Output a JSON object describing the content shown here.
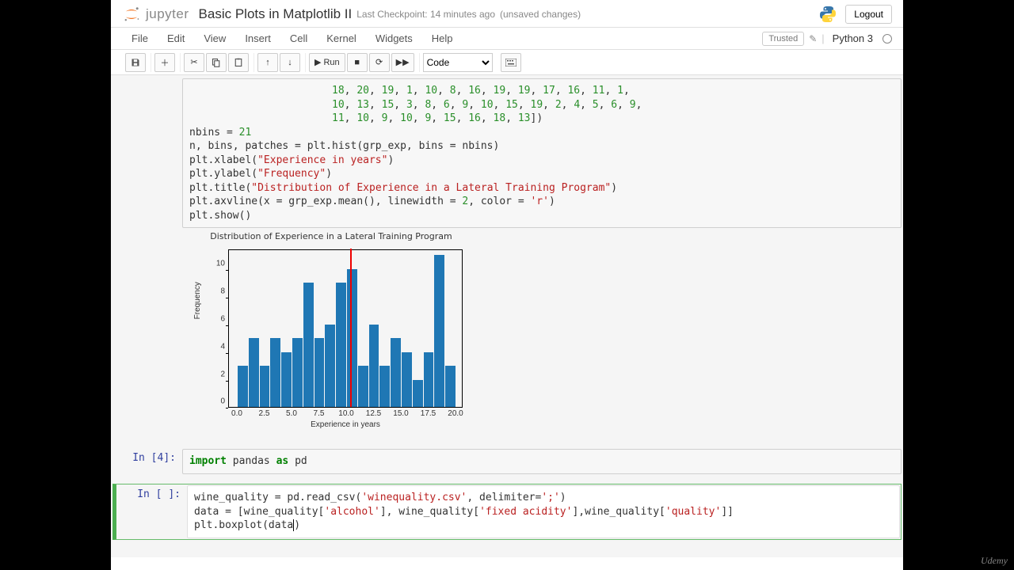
{
  "header": {
    "logo_text": "jupyter",
    "title": "Basic Plots in Matplotlib II",
    "checkpoint": "Last Checkpoint: 14 minutes ago",
    "unsaved": "(unsaved changes)",
    "logout": "Logout"
  },
  "menubar": {
    "items": [
      "File",
      "Edit",
      "View",
      "Insert",
      "Cell",
      "Kernel",
      "Widgets",
      "Help"
    ],
    "trusted": "Trusted",
    "kernel": "Python 3"
  },
  "toolbar": {
    "run_label": "Run",
    "celltype": "Code"
  },
  "cells": {
    "code1_prefix_lines": [
      "                       18, 20, 19, 1, 10, 8, 16, 19, 19, 17, 16, 11, 1,",
      "                       10, 13, 15, 3, 8, 6, 9, 10, 15, 19, 2, 4, 5, 6, 9,",
      "                       11, 10, 9, 10, 9, 15, 16, 18, 13])"
    ],
    "code1_nbins": "nbins = 21",
    "code1_hist": "n, bins, patches = plt.hist(grp_exp, bins = nbins)",
    "code1_xlabel": "plt.xlabel(\"Experience in years\")",
    "code1_ylabel": "plt.ylabel(\"Frequency\")",
    "code1_title": "plt.title(\"Distribution of Experience in a Lateral Training Program\")",
    "code1_axv": "plt.axvline(x = grp_exp.mean(), linewidth = 2, color = 'r')",
    "code1_show": "plt.show()",
    "in4_prompt": "In [4]:",
    "in4_code": "import pandas as pd",
    "in_empty_prompt": "In [ ]:",
    "nb_line1": "wine_quality = pd.read_csv('winequality.csv', delimiter=';')",
    "nb_line2": "data = [wine_quality['alcohol'], wine_quality['fixed acidity'],wine_quality['quality']]",
    "nb_line3": "plt.boxplot(data)"
  },
  "chart_data": {
    "type": "bar",
    "title": "Distribution of Experience in a Lateral Training Program",
    "xlabel": "Experience in years",
    "ylabel": "Frequency",
    "bin_edges_display": [
      "0.0",
      "2.5",
      "5.0",
      "7.5",
      "10.0",
      "12.5",
      "15.0",
      "17.5",
      "20.0"
    ],
    "ytick_labels": [
      "0",
      "2",
      "4",
      "6",
      "8",
      "10"
    ],
    "ylim": [
      0,
      11
    ],
    "bars": [
      {
        "x": 1,
        "h": 3
      },
      {
        "x": 2,
        "h": 5
      },
      {
        "x": 3,
        "h": 3
      },
      {
        "x": 4,
        "h": 5
      },
      {
        "x": 5,
        "h": 4
      },
      {
        "x": 6,
        "h": 5
      },
      {
        "x": 7,
        "h": 9
      },
      {
        "x": 8,
        "h": 5
      },
      {
        "x": 9,
        "h": 6
      },
      {
        "x": 10,
        "h": 9
      },
      {
        "x": 11,
        "h": 10
      },
      {
        "x": 12,
        "h": 3
      },
      {
        "x": 13,
        "h": 6
      },
      {
        "x": 14,
        "h": 3
      },
      {
        "x": 15,
        "h": 5
      },
      {
        "x": 16,
        "h": 4
      },
      {
        "x": 17,
        "h": 2
      },
      {
        "x": 18,
        "h": 4
      },
      {
        "x": 19,
        "h": 11
      },
      {
        "x": 20,
        "h": 3
      }
    ],
    "mean_x": 10.4,
    "x_range": [
      0,
      20
    ]
  },
  "footer": {
    "brand": "Udemy"
  }
}
